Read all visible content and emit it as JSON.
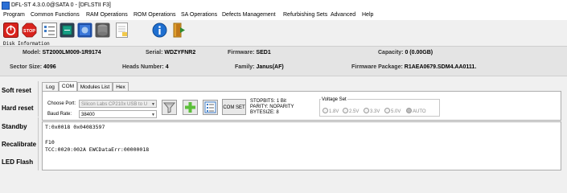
{
  "window": {
    "title": "DFL-ST 4.3.0.0@SATA 0 - [DFLSTII F3]"
  },
  "menu": [
    "Program",
    "Common Functions",
    "RAM Operations",
    "ROM Operations",
    "SA Operations",
    "Defects Management",
    "Refurbishing Sets",
    "Advanced",
    "Help"
  ],
  "toolbar": {
    "stop_label": "STOP"
  },
  "disk_info": {
    "section_label": "Disk Information",
    "model_label": "Model:",
    "model_value": "ST2000LM009-1R9174",
    "serial_label": "Serial:",
    "serial_value": "WDZYFNR2",
    "firmware_label": "Firmware:",
    "firmware_value": "SED1",
    "capacity_label": "Capacity:",
    "capacity_value": "0 (0.00GB)",
    "sector_label": "Sector Size:",
    "sector_value": "4096",
    "heads_label": "Heads Number:",
    "heads_value": "4",
    "family_label": "Family:",
    "family_value": "Janus(AF)",
    "fwpkg_label": "Firmware Package:",
    "fwpkg_value": "R1AEA0679.SDM4.AA0111."
  },
  "side_buttons": [
    "Soft reset",
    "Hard reset",
    "Standby",
    "Recalibrate",
    "LED Flash"
  ],
  "tabs": [
    "Log",
    "COM",
    "Modules List",
    "Hex"
  ],
  "com": {
    "choose_port_label": "Choose Port:",
    "port_value": "Silicon Labs CP210x USB to U",
    "baud_label": "Baud Rate:",
    "baud_value": "38400",
    "comset_label": "COM SET",
    "stopbits": "STOPBITS: 1 Bit",
    "parity": "PARITY: NOPARITY",
    "bytesize": "BYTESIZE: 8",
    "voltage_title": "Voltage Set",
    "voltage_options": [
      "1.8V",
      "2.5V",
      "3.3V",
      "5.0V",
      "AUTO"
    ],
    "voltage_selected": "AUTO"
  },
  "terminal": [
    "T:0x0018 0x04083597",
    "",
    "F10",
    "TCC:0020:002A EWCDataErr:00000018"
  ],
  "colors": {
    "stop_red": "#d9231d",
    "info_blue": "#1f6fd0",
    "plus_green": "#5bbf3a"
  }
}
